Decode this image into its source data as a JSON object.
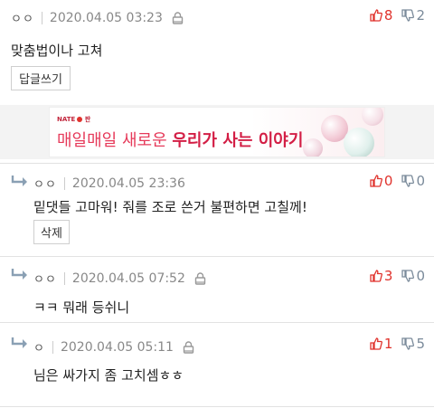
{
  "comments": [
    {
      "nick": "ㅇㅇ",
      "date": "2020.04.05 03:23",
      "up": "8",
      "down": "2",
      "text": "맞춤법이나 고쳐",
      "button": "답글쓰기"
    }
  ],
  "ad": {
    "logo": "NATE",
    "logo_suffix": "판",
    "text_plain": "매일매일 새로운 ",
    "text_bold": "우리가 사는 이야기."
  },
  "replies": [
    {
      "nick": "ㅇㅇ",
      "date": "2020.04.05 23:36",
      "up": "0",
      "down": "0",
      "text": "밑댓들 고마워! 줘를 조로 쓴거 불편하면 고칠께!",
      "button": "삭제"
    },
    {
      "nick": "ㅇㅇ",
      "date": "2020.04.05 07:52",
      "up": "3",
      "down": "0",
      "text": "ㅋㅋ 뭐래 등쉬니"
    },
    {
      "nick": "ㅇ",
      "date": "2020.04.05 05:11",
      "up": "1",
      "down": "5",
      "text": "님은 싸가지 좀 고치셈ㅎㅎ"
    }
  ],
  "colors": {
    "up": "#e0322c",
    "down": "#7a8a9a",
    "ad_accent": "#d31e45"
  }
}
